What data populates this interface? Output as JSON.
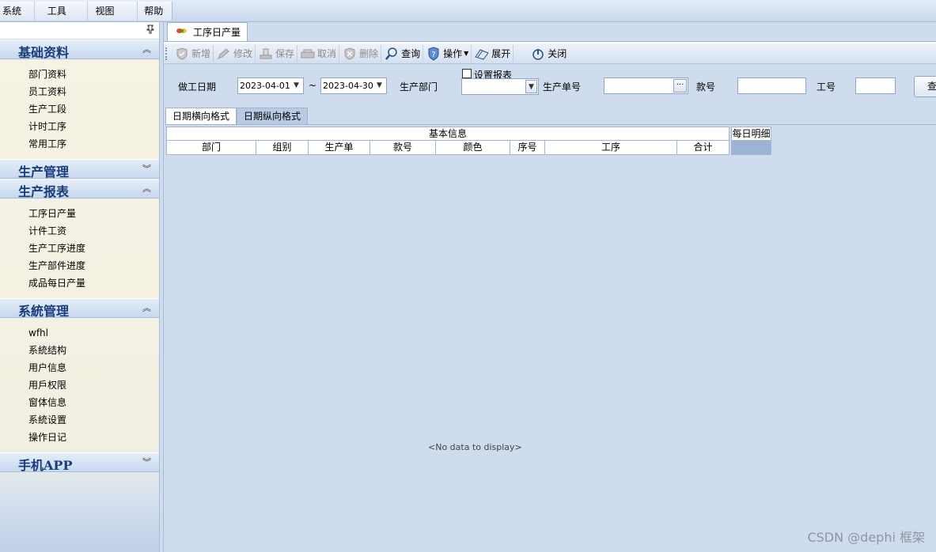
{
  "menubar": {
    "items": [
      "系统",
      "工具",
      "视图",
      "帮助"
    ]
  },
  "nav": {
    "pin_glyph": "📌",
    "groups": [
      {
        "title": "基础资料",
        "expanded": true,
        "items": [
          "部门资料",
          "员工资料",
          "生产工段",
          "计时工序",
          "常用工序"
        ]
      },
      {
        "title": "生产管理",
        "expanded": false,
        "items": []
      },
      {
        "title": "生产报表",
        "expanded": true,
        "items": [
          "工序日产量",
          "计件工资",
          "生产工序进度",
          "生产部件进度",
          "成品每日产量"
        ]
      },
      {
        "title": "系統管理",
        "expanded": true,
        "items": [
          "wfhl",
          "系統结构",
          "用户信息",
          "用戶权限",
          "窗体信息",
          "系統设置",
          "操作日记"
        ]
      },
      {
        "title": "手机APP",
        "expanded": false,
        "items": []
      }
    ]
  },
  "doc_tab": {
    "label": "工序日产量"
  },
  "toolbar": {
    "buttons": [
      {
        "label": "新增",
        "icon": "shield-icon",
        "enabled": false
      },
      {
        "label": "修改",
        "icon": "pencil-icon",
        "enabled": false
      },
      {
        "label": "保存",
        "icon": "save-icon",
        "enabled": false
      },
      {
        "label": "取消",
        "icon": "cancel-icon",
        "enabled": false
      },
      {
        "label": "删除",
        "icon": "delete-icon",
        "enabled": false
      },
      {
        "label": "查询",
        "icon": "search-icon",
        "enabled": true
      },
      {
        "label": "操作",
        "icon": "help-shield-icon",
        "enabled": true,
        "dropdown": true
      },
      {
        "label": "展开",
        "icon": "expand-icon",
        "enabled": true
      },
      {
        "label": "关闭",
        "icon": "power-icon",
        "enabled": true
      }
    ]
  },
  "filter": {
    "work_date_label": "做工日期",
    "date_from": "2023-04-01",
    "tilde": "~",
    "date_to": "2023-04-30",
    "dept_label": "生产部门",
    "dept_value": "",
    "set_report_label": "设置报表",
    "order_label": "生产单号",
    "order_value": "",
    "style_label": "款号",
    "style_value": "",
    "worker_label": "工号",
    "worker_value": "",
    "query_label": "查"
  },
  "sub_tabs": [
    "日期横向格式",
    "日期纵向格式"
  ],
  "grid": {
    "band_basic": "基本信息",
    "band_daily": "每日明细",
    "columns": [
      "部门",
      "组别",
      "生产单",
      "款号",
      "颜色",
      "序号",
      "工序",
      "合计"
    ],
    "empty_text": "<No data to display>"
  },
  "watermark": "CSDN @dephi 框架"
}
